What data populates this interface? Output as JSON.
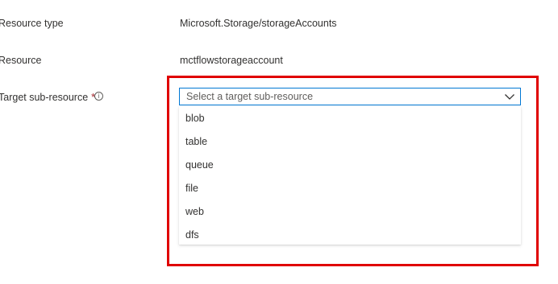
{
  "form": {
    "resource_type_label": "Resource type",
    "resource_type_value": "Microsoft.Storage/storageAccounts",
    "resource_label": "Resource",
    "resource_value": "mctflowstorageaccount",
    "target_label": "Target sub-resource",
    "required_marker": "*",
    "info_glyph": "i",
    "target_placeholder": "Select a target sub-resource"
  },
  "dropdown": {
    "options": [
      "blob",
      "table",
      "queue",
      "file",
      "web",
      "dfs"
    ]
  },
  "colors": {
    "highlight": "#e00000",
    "focus_border": "#0078d4",
    "required": "#a4262c"
  },
  "icons": {
    "chevron": "chevron-down-icon",
    "info": "info-icon"
  }
}
